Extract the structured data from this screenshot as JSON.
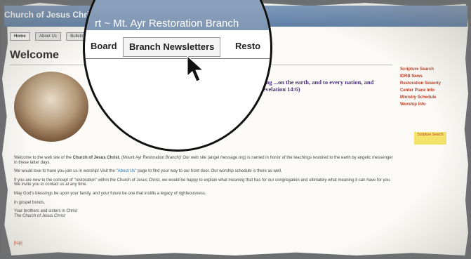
{
  "header": {
    "site_title": "Church of Jesus Christ"
  },
  "nav": {
    "items": [
      "Home",
      "About Us",
      "Bulletin Board",
      "Branch Newsletters",
      "Restoration"
    ]
  },
  "welcome": "Welcome",
  "verse": "...midst of heaven, having the everlasting ...on the earth, and to every nation, and kindred, and tongue, and people... (Revelation 14:6)",
  "sidebar": {
    "links": [
      "Scripture Search",
      "IDRB News",
      "Restoration Seventy",
      "Center Place Info",
      "Ministry Schedule",
      "Worship Info"
    ]
  },
  "scripture_badge": "Scripture Search",
  "body": {
    "p1_a": "Welcome to the web site of the ",
    "p1_b": "Church of Jesus Christ",
    "p1_c": ", (Mount Ayr Restoration Branch)! Our web site (angel message.org) is named in honor of the teachings restored to the earth by angelic messenger in these latter days.",
    "p2_a": "We would love to have you join us in worship! Visit the ",
    "p2_b": "\"About Us\"",
    "p2_c": " page to find your way to our front door. Our worship schedule is there as well.",
    "p3": "If you are new to the concept of \"restoration\" within the Church of Jesus Christ, we would be happy to explain what meaning that has for our congregation and ultimately what meaning it can have for you. We invite you to contact us at any time.",
    "p4": "May God's blessings be upon your family, and your future be one that instills a legacy of righteousness.",
    "p5": "In gospel bonds,",
    "p6_a": "Your brothers and sisters in Christ",
    "p6_b": "The Church of Jesus Christ",
    "top": "[top]"
  },
  "magnifier": {
    "title": "rt ~ Mt. Ayr Restoration Branch",
    "tab_board": "Board",
    "tab_newsletters": "Branch Newsletters",
    "tab_resto": "Resto"
  }
}
